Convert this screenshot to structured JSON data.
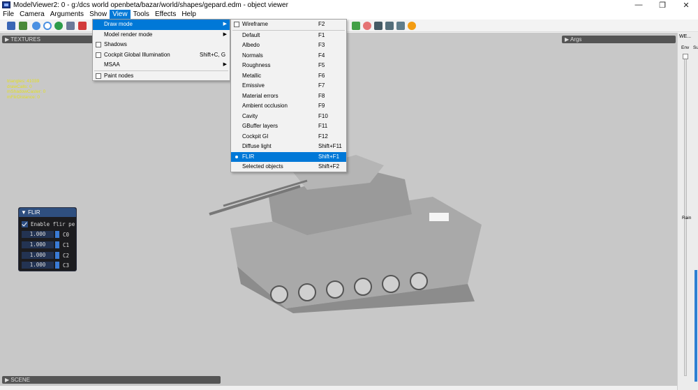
{
  "window": {
    "title": "ModelViewer2: 0 - g:/dcs world openbeta/bazar/world/shapes/gepard.edm - object viewer",
    "minimize": "—",
    "maximize": "❐",
    "close": "✕"
  },
  "menubar": [
    "File",
    "Camera",
    "Arguments",
    "Show",
    "View",
    "Tools",
    "Effects",
    "Help"
  ],
  "panels": {
    "textures": "TEXTURES",
    "args": "Args",
    "scene": "SCENE",
    "right_title": "WE...",
    "env": "Env",
    "su": "Su",
    "rain": "Rain"
  },
  "stats": [
    "triangles: 41039",
    "drawCalls: 0",
    "mShadowCaster: 0",
    "mFlirDistance: 0"
  ],
  "flir": {
    "title": "FLIR",
    "enable_label": "Enable flir pe",
    "params": [
      {
        "value": "1.000",
        "label": "C0"
      },
      {
        "value": "1.000",
        "label": "C1"
      },
      {
        "value": "1.000",
        "label": "C2"
      },
      {
        "value": "1.000",
        "label": "C3"
      }
    ]
  },
  "view_menu": {
    "items": [
      {
        "label": "Draw mode",
        "has_submenu": true
      },
      {
        "label": "Model render mode",
        "has_submenu": true
      },
      {
        "label": "Shadows",
        "checkbox": true
      },
      {
        "label": "Cockpit Global Illumination",
        "shortcut": "Shift+C, G",
        "checkbox": true
      },
      {
        "label": "MSAA",
        "has_submenu": true
      },
      {
        "label": "Paint nodes",
        "checkbox": true
      }
    ]
  },
  "draw_mode_menu": {
    "items": [
      {
        "label": "Wireframe",
        "shortcut": "F2"
      },
      {
        "label": "Default",
        "shortcut": "F1"
      },
      {
        "label": "Albedo",
        "shortcut": "F3"
      },
      {
        "label": "Normals",
        "shortcut": "F4"
      },
      {
        "label": "Roughness",
        "shortcut": "F5"
      },
      {
        "label": "Metallic",
        "shortcut": "F6"
      },
      {
        "label": "Emissive",
        "shortcut": "F7"
      },
      {
        "label": "Material errors",
        "shortcut": "F8"
      },
      {
        "label": "Ambient occlusion",
        "shortcut": "F9"
      },
      {
        "label": "Cavity",
        "shortcut": "F10"
      },
      {
        "label": "GBuffer layers",
        "shortcut": "F11"
      },
      {
        "label": "Cockpit GI",
        "shortcut": "F12"
      },
      {
        "label": "Diffuse light",
        "shortcut": "Shift+F11"
      },
      {
        "label": "FLIR",
        "shortcut": "Shift+F1",
        "selected": true
      },
      {
        "label": "Selected objects",
        "shortcut": "Shift+F2"
      }
    ]
  },
  "colors": {
    "accent": "#0078d7",
    "viewport": "#c8c8c8",
    "stats_text": "#e3df1b",
    "flir_header": "#2f4f7f"
  }
}
